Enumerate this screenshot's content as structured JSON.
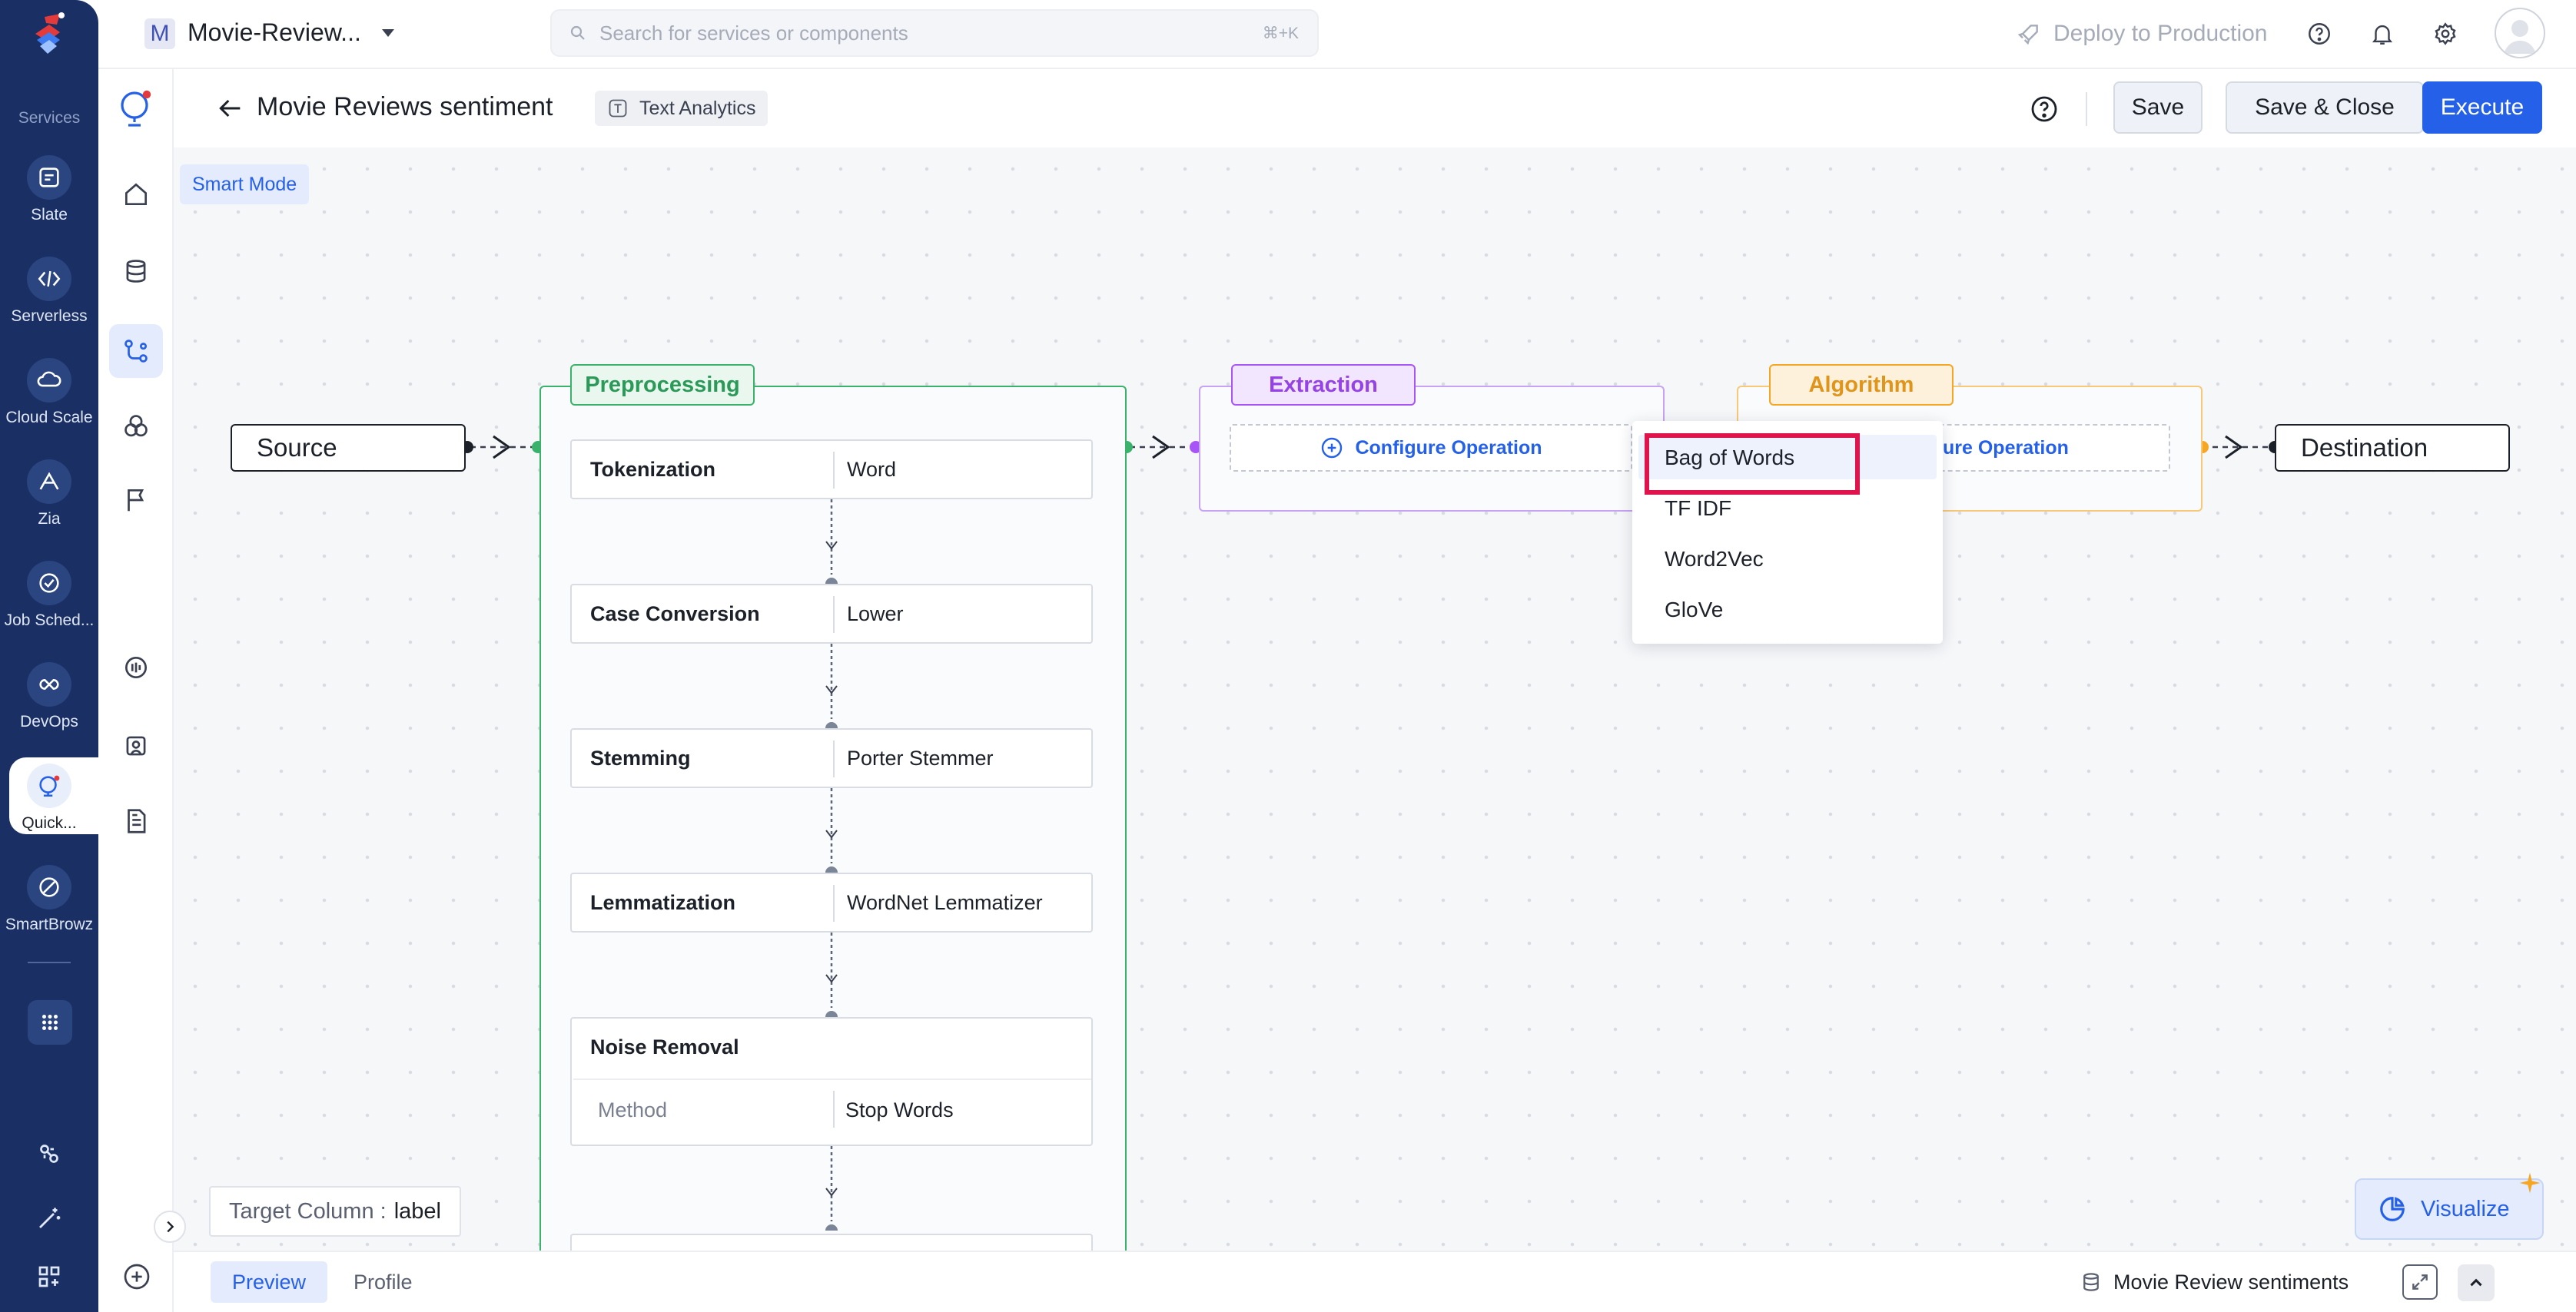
{
  "nav": {
    "items": [
      {
        "label": "Services",
        "icon": "services-icon"
      },
      {
        "label": "Slate",
        "icon": "slate-icon"
      },
      {
        "label": "Serverless",
        "icon": "serverless-icon"
      },
      {
        "label": "Cloud Scale",
        "icon": "cloud-scale-icon"
      },
      {
        "label": "Zia",
        "icon": "zia-icon"
      },
      {
        "label": "Job Sched...",
        "icon": "job-scheduling-icon"
      },
      {
        "label": "DevOps",
        "icon": "devops-icon"
      },
      {
        "label": "Quick...",
        "icon": "quickml-icon"
      },
      {
        "label": "SmartBrowz",
        "icon": "smartbrowz-icon"
      }
    ]
  },
  "topbar": {
    "project_initial": "M",
    "project_name": "Movie-Review...",
    "search_placeholder": "Search for services or components",
    "search_shortcut": "⌘+K",
    "deploy_label": "Deploy to Production"
  },
  "header": {
    "title": "Movie Reviews sentiment",
    "tag": "Text Analytics",
    "save": "Save",
    "save_close": "Save & Close",
    "execute": "Execute"
  },
  "canvas": {
    "mode_badge": "Smart Mode",
    "source": "Source",
    "destination": "Destination",
    "preprocessing": {
      "label": "Preprocessing",
      "steps": [
        {
          "name": "Tokenization",
          "value": "Word"
        },
        {
          "name": "Case Conversion",
          "value": "Lower"
        },
        {
          "name": "Stemming",
          "value": "Porter Stemmer"
        },
        {
          "name": "Lemmatization",
          "value": "WordNet Lemmatizer"
        }
      ],
      "noise": {
        "name": "Noise Removal",
        "method_label": "Method",
        "method_value": "Stop Words"
      }
    },
    "extraction": {
      "label": "Extraction",
      "configure": "Configure Operation"
    },
    "algorithm": {
      "label": "Algorithm",
      "configure": "ure Operation"
    },
    "dropdown": {
      "options": [
        "Bag of Words",
        "TF IDF",
        "Word2Vec",
        "GloVe"
      ],
      "highlighted": "Bag of Words"
    },
    "target_column": {
      "label": "Target Column :",
      "value": "label"
    },
    "visualize": "Visualize"
  },
  "bottom": {
    "tabs": [
      "Preview",
      "Profile"
    ],
    "dataset": "Movie Review sentiments"
  },
  "colors": {
    "nav_bg": "#1a2f63",
    "primary": "#2560e8",
    "preprocessing": "#3bb26b",
    "extraction": "#a855f7",
    "algorithm": "#f5a623",
    "highlight": "#e0144c"
  }
}
